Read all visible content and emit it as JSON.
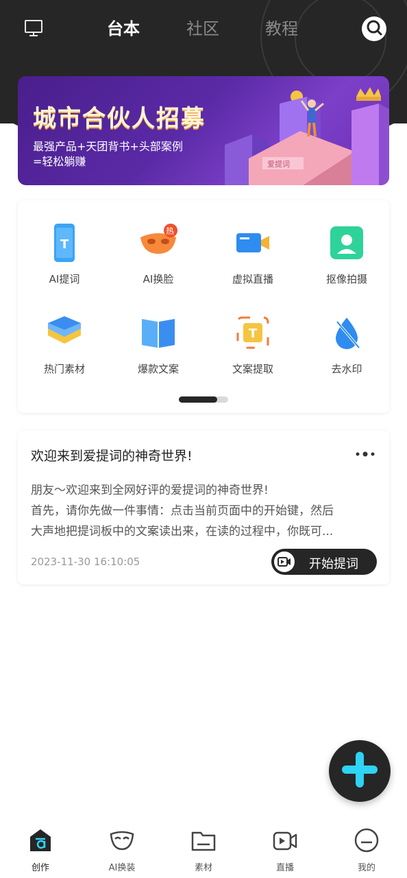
{
  "header": {
    "tabs": [
      {
        "label": "台本",
        "active": true
      },
      {
        "label": "社区",
        "active": false
      },
      {
        "label": "教程",
        "active": false
      }
    ],
    "left_icon": "monitor-icon",
    "right_icon": "search-icon"
  },
  "banner": {
    "title": "城市合伙人招募",
    "subtitle_line1": "最强产品+天团背书+头部案例",
    "subtitle_line2": "=轻松躺赚",
    "building_sign": "爱提词"
  },
  "tools": {
    "items": [
      {
        "label": "AI提词",
        "icon": "teleprompter-phone-icon"
      },
      {
        "label": "AI换脸",
        "icon": "mask-icon",
        "badge": "热"
      },
      {
        "label": "虚拟直播",
        "icon": "video-camera-icon"
      },
      {
        "label": "抠像拍摄",
        "icon": "portrait-icon"
      },
      {
        "label": "热门素材",
        "icon": "layers-icon"
      },
      {
        "label": "爆款文案",
        "icon": "book-icon"
      },
      {
        "label": "文案提取",
        "icon": "text-extract-icon"
      },
      {
        "label": "去水印",
        "icon": "no-watermark-icon"
      }
    ],
    "page_index": 1,
    "page_count": 2
  },
  "script_card": {
    "title": "欢迎来到爱提词的神奇世界!",
    "body_lines": [
      "朋友～欢迎来到全网好评的爱提词的神奇世界!",
      "首先，请你先做一件事情：点击当前页面中的开始键，然后",
      "大声地把提词板中的文案读出来，在读的过程中，你既可..."
    ],
    "date": "2023-11-30 16:10:05",
    "start_button": "开始提词"
  },
  "fab": {
    "icon": "plus-icon",
    "accent": "#2ed3f5"
  },
  "bottom_nav": {
    "items": [
      {
        "label": "创作",
        "icon": "create-icon",
        "active": true
      },
      {
        "label": "AI换装",
        "icon": "mask-outline-icon",
        "active": false
      },
      {
        "label": "素材",
        "icon": "folder-icon",
        "active": false
      },
      {
        "label": "直播",
        "icon": "live-camera-icon",
        "active": false
      },
      {
        "label": "我的",
        "icon": "profile-face-icon",
        "active": false
      }
    ]
  },
  "colors": {
    "header_bg": "#262626",
    "accent": "#2ed3f5"
  }
}
